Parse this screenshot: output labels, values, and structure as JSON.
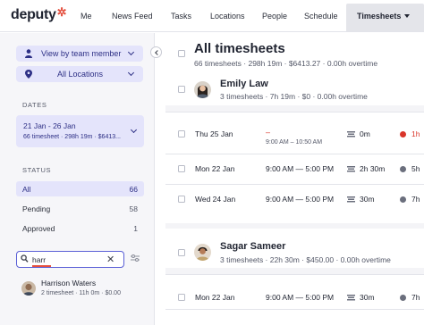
{
  "app": {
    "logo": "deputy",
    "logo_mark": "✲",
    "nav": [
      "Me",
      "News Feed",
      "Tasks",
      "Locations",
      "People",
      "Schedule"
    ],
    "nav_active": "Timesheets"
  },
  "sidebar": {
    "view_by": "View by team member",
    "locations": "All Locations",
    "dates_label": "DATES",
    "date_range": "21 Jan - 26 Jan",
    "date_summary": "66 timesheet · 298h 19m · $6413...",
    "status_label": "STATUS",
    "status": [
      {
        "label": "All",
        "count": "66"
      },
      {
        "label": "Pending",
        "count": "58"
      },
      {
        "label": "Approved",
        "count": "1"
      }
    ],
    "search_value": "harr",
    "result": {
      "name": "Harrison Waters",
      "meta": "2 timesheet · 11h 0m · $0.00"
    }
  },
  "main": {
    "title": "All timesheets",
    "summary": "66 timesheets · 298h 19m · $6413.27 · 0.00h overtime",
    "groups": [
      {
        "name": "Emily Law",
        "meta": "3 timesheets · 7h 19m · $0 · 0.00h overtime",
        "rows": [
          {
            "date": "Thu 25 Jan",
            "time": "–",
            "sub": "9:00 AM – 10:50 AM",
            "break": "0m",
            "hours": "1h"
          },
          {
            "date": "Mon 22 Jan",
            "time": "9:00 AM — 5:00 PM",
            "sub": "",
            "break": "2h 30m",
            "hours": "5h"
          },
          {
            "date": "Wed 24 Jan",
            "time": "9:00 AM — 5:00 PM",
            "sub": "",
            "break": "30m",
            "hours": "7h"
          }
        ]
      },
      {
        "name": "Sagar Sameer",
        "meta": "3 timesheets · 22h 30m · $450.00 · 0.00h overtime",
        "rows": [
          {
            "date": "Mon 22 Jan",
            "time": "9:00 AM — 5:00 PM",
            "sub": "",
            "break": "30m",
            "hours": "7h"
          }
        ]
      }
    ]
  },
  "colors": {
    "accent": "#2d2f85",
    "selection_bg": "#e4e4fb",
    "brand_red": "#e4503f",
    "warning": "#d9352a"
  }
}
